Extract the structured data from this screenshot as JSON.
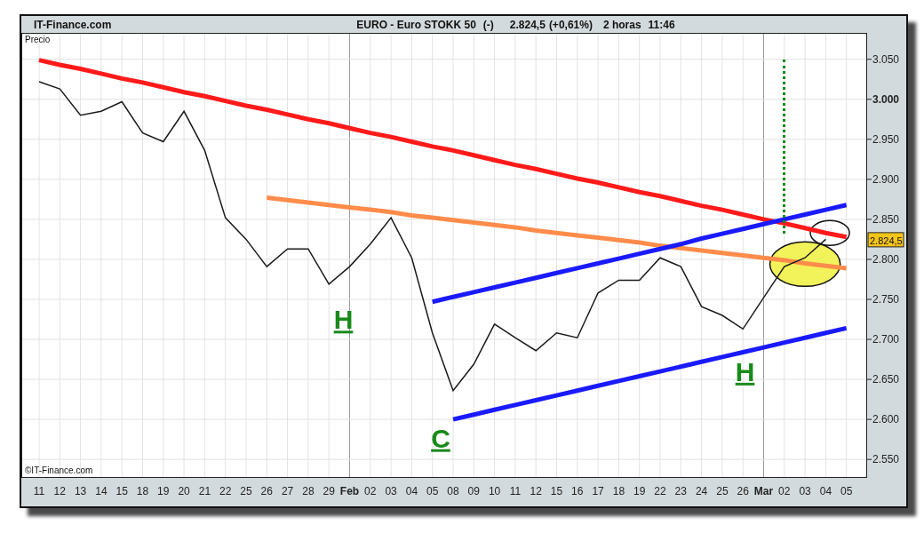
{
  "header": {
    "site": "IT-Finance.com",
    "flag": "(-)",
    "price": "2.824,5",
    "change": "(+0,61%)",
    "period": "2 horas",
    "time": "11:46"
  },
  "chart": {
    "copyright": "©IT-Finance.com",
    "price_tag": "2.824,5",
    "pattern_labels": [
      {
        "text": "H"
      },
      {
        "text": "C"
      },
      {
        "text": "H"
      }
    ],
    "chart_data": {
      "type": "line",
      "ylabel": "Precio",
      "grid": true,
      "categories": [
        "11",
        "12",
        "13",
        "14",
        "15",
        "18",
        "19",
        "20",
        "21",
        "22",
        "25",
        "26",
        "27",
        "28",
        "29",
        "Feb",
        "02",
        "03",
        "04",
        "05",
        "08",
        "09",
        "10",
        "11",
        "12",
        "15",
        "16",
        "17",
        "18",
        "19",
        "22",
        "23",
        "24",
        "25",
        "26",
        "Mar",
        "02",
        "03",
        "04",
        "05"
      ],
      "series": [
        {
          "name": "EURO - Euro STOKK 50",
          "color": "#1a1a1a",
          "values": [
            3022,
            3013,
            2980,
            2985,
            2997,
            2958,
            2947,
            2985,
            2936,
            2852,
            2825,
            2791,
            2813,
            2813,
            2769,
            2791,
            2819,
            2852,
            2802,
            2708,
            2636,
            2669,
            2719,
            2702,
            2686,
            2708,
            2702,
            2758,
            2774,
            2774,
            2802,
            2791,
            2741,
            2730,
            2713,
            2752,
            2791,
            2802,
            2825,
            null
          ]
        },
        {
          "color": "#ff1a1a",
          "values": [
            3049,
            3043,
            3038,
            3032,
            3026,
            3021,
            3015,
            3009,
            3004,
            2998,
            2992,
            2987,
            2981,
            2975,
            2970,
            2964,
            2958,
            2953,
            2947,
            2941,
            2936,
            2930,
            2924,
            2918,
            2913,
            2907,
            2901,
            2896,
            2890,
            2884,
            2879,
            2873,
            2867,
            2862,
            2856,
            2850,
            2845,
            2839,
            2833,
            2828
          ]
        },
        {
          "color": "#ff8c4a",
          "values": [
            null,
            null,
            null,
            null,
            null,
            null,
            null,
            null,
            null,
            null,
            null,
            2877,
            2874,
            2871,
            2868,
            2865,
            2862,
            2859,
            2855,
            2852,
            2849,
            2846,
            2843,
            2840,
            2836,
            2833,
            2830,
            2827,
            2824,
            2821,
            2817,
            2814,
            2811,
            2808,
            2805,
            2802,
            2799,
            2795,
            2792,
            2789
          ]
        },
        {
          "color": "#1a1aff",
          "values": [
            null,
            null,
            null,
            null,
            null,
            null,
            null,
            null,
            null,
            null,
            null,
            null,
            null,
            null,
            null,
            null,
            null,
            null,
            null,
            2747,
            2753,
            2759,
            2765,
            2771,
            2777,
            2783,
            2789,
            2795,
            2801,
            2807,
            2813,
            2819,
            2826,
            2832,
            2838,
            2844,
            2850,
            2856,
            2862,
            2868
          ]
        },
        {
          "color": "#1a1aff",
          "values": [
            null,
            null,
            null,
            null,
            null,
            null,
            null,
            null,
            null,
            null,
            null,
            null,
            null,
            null,
            null,
            null,
            null,
            null,
            null,
            null,
            2600,
            2606,
            2612,
            2618,
            2624,
            2630,
            2636,
            2642,
            2648,
            2654,
            2660,
            2666,
            2672,
            2678,
            2684,
            2690,
            2696,
            2702,
            2708,
            2714
          ]
        }
      ],
      "ylim": [
        2528,
        3083
      ],
      "yticks": [
        {
          "value": 2550,
          "label": "2.550"
        },
        {
          "value": 2600,
          "label": "2.600"
        },
        {
          "value": 2650,
          "label": "2.650"
        },
        {
          "value": 2700,
          "label": "2.700"
        },
        {
          "value": 2750,
          "label": "2.750"
        },
        {
          "value": 2800,
          "label": "2.800"
        },
        {
          "value": 2850,
          "label": "2.850"
        },
        {
          "value": 2900,
          "label": "2.900"
        },
        {
          "value": 2950,
          "label": "2.950"
        },
        {
          "value": 3000,
          "label": "3.000"
        },
        {
          "value": 3050,
          "label": "3.050"
        }
      ]
    }
  }
}
